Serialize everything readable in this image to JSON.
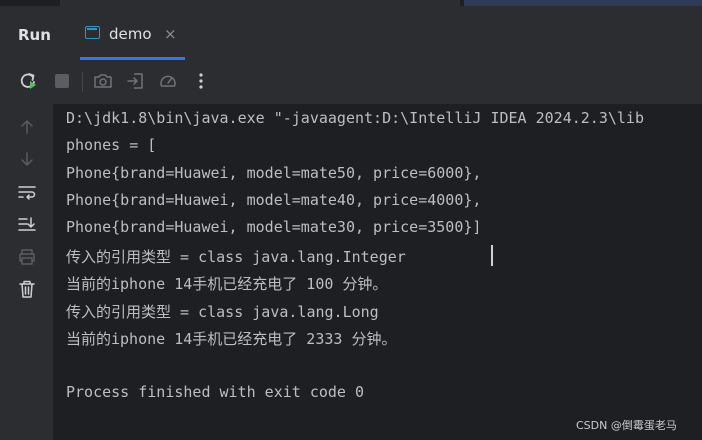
{
  "tool_window": {
    "title": "Run",
    "tabs": [
      {
        "label": "demo",
        "icon": "console-icon",
        "close_icon": "close-icon",
        "active": true
      }
    ],
    "close_glyph": "×"
  },
  "toolbar": {
    "buttons": [
      {
        "icon": "rerun-icon",
        "enabled": true
      },
      {
        "icon": "stop-icon",
        "enabled": false
      },
      {
        "icon": "camera-icon",
        "enabled": false
      },
      {
        "icon": "export-icon",
        "enabled": false
      },
      {
        "icon": "gauge-icon",
        "enabled": false
      },
      {
        "icon": "more-vertical-icon",
        "enabled": true
      }
    ]
  },
  "sidebar": {
    "buttons": [
      {
        "icon": "arrow-up-icon"
      },
      {
        "icon": "arrow-down-icon"
      },
      {
        "icon": "soft-wrap-icon"
      },
      {
        "icon": "scroll-to-end-icon"
      },
      {
        "icon": "print-icon"
      },
      {
        "icon": "trash-icon"
      }
    ]
  },
  "console": {
    "lines": [
      "D:\\jdk1.8\\bin\\java.exe \"-javaagent:D:\\IntelliJ IDEA 2024.2.3\\lib",
      "phones = [",
      "Phone{brand=Huawei, model=mate50, price=6000},",
      "Phone{brand=Huawei, model=mate40, price=4000},",
      "Phone{brand=Huawei, model=mate30, price=3500}]",
      "传入的引用类型 = class java.lang.Integer",
      "当前的iphone 14手机已经充电了 100 分钟。",
      "传入的引用类型 = class java.lang.Long",
      "当前的iphone 14手机已经充电了 2333 分钟。",
      "",
      "Process finished with exit code 0"
    ]
  },
  "watermark": "CSDN @倒霉蛋老马",
  "colors": {
    "background": "#1e1f22",
    "panel": "#2b2d30",
    "text": "#bcbec4",
    "accent": "#3574f0",
    "rerun": "#5fb865"
  }
}
